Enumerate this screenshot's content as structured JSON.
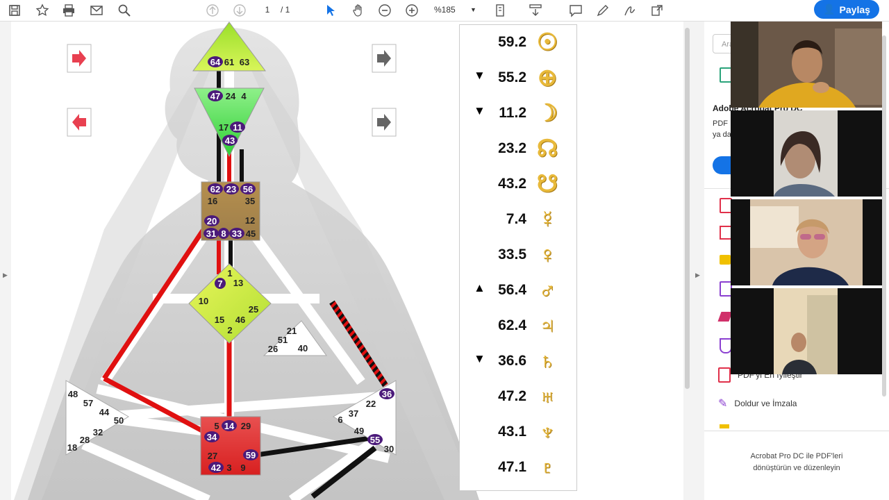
{
  "toolbar": {
    "page_current": "1",
    "page_total": "/ 1",
    "zoom": "%185",
    "share_label": "Paylaş",
    "icons": [
      "save-icon",
      "star-icon",
      "print-icon",
      "mail-icon",
      "search-icon",
      "page-up-icon",
      "page-down-icon",
      "select-cursor-icon",
      "hand-icon",
      "zoom-out-icon",
      "zoom-in-icon",
      "fit-page-icon",
      "scroll-mode-icon",
      "comment-icon",
      "pen-icon",
      "sign-icon",
      "share-doc-icon"
    ]
  },
  "bodygraph": {
    "head_gates": [
      "64",
      "61",
      "63"
    ],
    "ajna_gates": [
      "47",
      "24",
      "4",
      "17",
      "11",
      "43"
    ],
    "throat_gates": [
      "62",
      "23",
      "56",
      "16",
      "35",
      "20",
      "12",
      "31",
      "8",
      "33",
      "45"
    ],
    "g_gates": [
      "1",
      "7",
      "13",
      "10",
      "25",
      "15",
      "46",
      "2"
    ],
    "ego_gates": [
      "21",
      "51",
      "26",
      "40"
    ],
    "spleen_gates": [
      "48",
      "57",
      "44",
      "50",
      "32",
      "28",
      "18"
    ],
    "solar_gates": [
      "36",
      "22",
      "37",
      "6",
      "49",
      "55",
      "30"
    ],
    "sacral_gates": [
      "5",
      "14",
      "29",
      "34",
      "27",
      "59",
      "42",
      "3",
      "9"
    ]
  },
  "planets": [
    {
      "mark": "",
      "value": "59.2",
      "symbol": "☉"
    },
    {
      "mark": "▼",
      "value": "55.2",
      "symbol": "⊕"
    },
    {
      "mark": "▼",
      "value": "11.2",
      "symbol": "☽"
    },
    {
      "mark": "",
      "value": "23.2",
      "symbol": "☊"
    },
    {
      "mark": "",
      "value": "43.2",
      "symbol": "☋"
    },
    {
      "mark": "",
      "value": "7.4",
      "symbol": "☿"
    },
    {
      "mark": "",
      "value": "33.5",
      "symbol": "♀"
    },
    {
      "mark": "▲",
      "value": "56.4",
      "symbol": "♂"
    },
    {
      "mark": "",
      "value": "62.4",
      "symbol": "♃"
    },
    {
      "mark": "▼",
      "value": "36.6",
      "symbol": "♄"
    },
    {
      "mark": "",
      "value": "47.2",
      "symbol": "♅"
    },
    {
      "mark": "",
      "value": "43.1",
      "symbol": "♆"
    },
    {
      "mark": "",
      "value": "47.1",
      "symbol": "♇"
    }
  ],
  "panel": {
    "search_placeholder": "Ara",
    "promo_title": "Adobe Acrobat Pro DC",
    "promo_text_1": "PDF",
    "promo_text_2": "ya da",
    "item_optimize": "PDF'yi En İyileştir",
    "item_fill_sign": "Doldur ve İmzala",
    "footer_line1": "Acrobat Pro DC ile PDF'leri",
    "footer_line2": "dönüştürün ve düzenleyin"
  },
  "colors": {
    "accent": "#1473e6",
    "gate_purple": "#4b1a7a",
    "channel_red": "#e01010",
    "symbol_gold": "#e8b93a"
  }
}
